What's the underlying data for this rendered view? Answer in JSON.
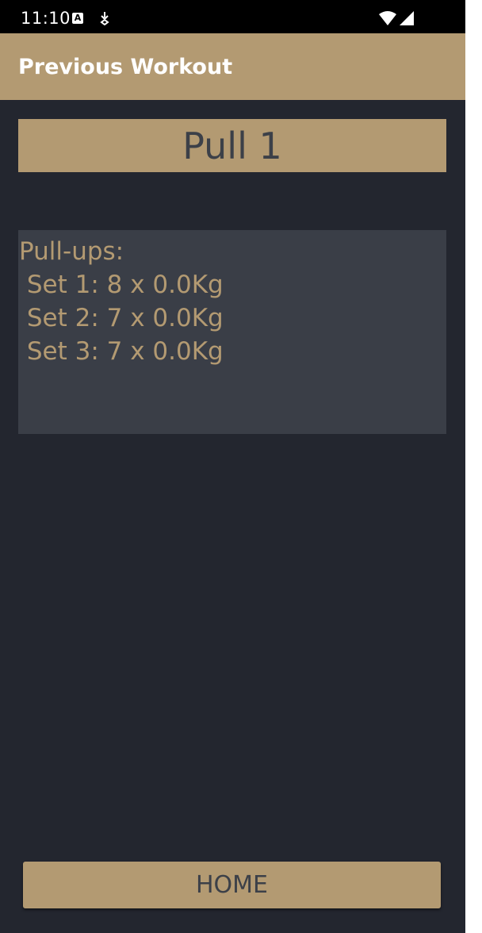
{
  "status_bar": {
    "time": "11:10",
    "icons": [
      "a-notification-icon",
      "download-icon",
      "wifi-icon",
      "signal-icon"
    ],
    "colors": {
      "background": "#000000",
      "text": "#ffffff"
    }
  },
  "app_bar": {
    "title": "Previous Workout",
    "colors": {
      "background": "#b39a72",
      "text": "#ffffff"
    }
  },
  "workout": {
    "name": "Pull 1",
    "details": "Pull-ups:\n Set 1: 8 x 0.0Kg\n Set 2: 7 x 0.0Kg\n Set 3: 7 x 0.0Kg"
  },
  "home_button": {
    "label": "HOME"
  },
  "theme": {
    "accent": "#b39a72",
    "background": "#23262f",
    "panel": "#3a3e47",
    "dark_text": "#3c4048"
  }
}
